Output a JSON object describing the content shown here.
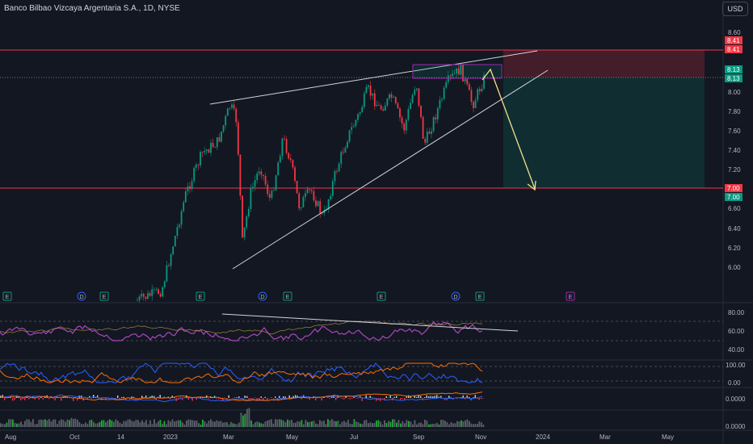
{
  "header": {
    "symbol_title": "Banco Bilbao Vizcaya Argentaria S.A., 1D, NYSE",
    "currency_button": "USD"
  },
  "price_axis": {
    "ticks": [
      "8.60",
      "8.41",
      "8.13",
      "8.00",
      "7.80",
      "7.60",
      "7.40",
      "7.20",
      "7.00",
      "6.80",
      "6.60",
      "6.40",
      "6.20",
      "6.00"
    ],
    "badges": [
      {
        "label": "8.41",
        "value": 8.41,
        "color": "#f23645"
      },
      {
        "label": "8.13",
        "value": 8.13,
        "color": "#089981"
      },
      {
        "label": "7.00",
        "value": 7.0,
        "color": "#f23645"
      }
    ]
  },
  "rsi_axis": {
    "ticks": [
      "80.00",
      "60.00",
      "40.00"
    ]
  },
  "stoch_axis": {
    "ticks": [
      "100.00",
      "0.00"
    ]
  },
  "macd_axis": {
    "ticks": [
      "0.0000"
    ]
  },
  "volume_axis": {
    "ticks": [
      "0.0000"
    ]
  },
  "time_axis": {
    "labels": [
      "Aug",
      "Oct",
      "14",
      "2023",
      "Mar",
      "May",
      "Jul",
      "Sep",
      "Nov",
      "2024",
      "Mar",
      "May"
    ]
  },
  "event_markers": [
    "E",
    "D",
    "E",
    "E",
    "D",
    "E",
    "E",
    "D",
    "E",
    "E"
  ],
  "colors": {
    "bg": "#131722",
    "up": "#089981",
    "down": "#f23645",
    "rsi": "#ab47bc",
    "target": "#f5e08a"
  }
}
